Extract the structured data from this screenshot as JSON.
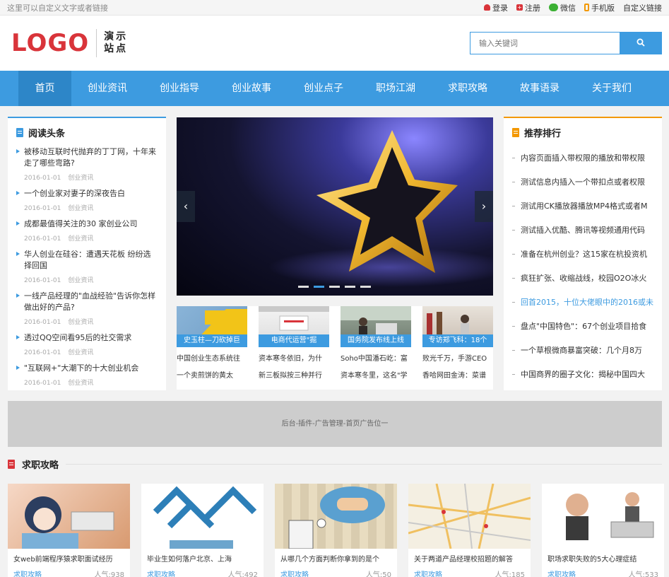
{
  "colors": {
    "accent": "#3d9be0",
    "nav_active": "#2d86c8",
    "brand_red": "#d9343a",
    "orange": "#f39800"
  },
  "topbar": {
    "left_text": "这里可以自定义文字或者链接",
    "login": "登录",
    "register": "注册",
    "wechat": "微信",
    "mobile": "手机版",
    "custom_link": "自定义链接"
  },
  "header": {
    "logo": "LOGO",
    "site_line1": "演示",
    "site_line2": "站点",
    "search_placeholder": "输入关键词",
    "search_icon": "search-icon"
  },
  "nav": [
    "首页",
    "创业资讯",
    "创业指导",
    "创业故事",
    "创业点子",
    "职场江湖",
    "求职攻略",
    "故事语录",
    "关于我们"
  ],
  "headlines": {
    "title": "阅读头条",
    "items": [
      {
        "title": "被移动互联时代抛弃的丁丁网，十年来走了哪些弯路?",
        "date": "2016-01-01",
        "cat": "创业资讯"
      },
      {
        "title": "一个创业家对妻子的深夜告白",
        "date": "2016-01-01",
        "cat": "创业资讯"
      },
      {
        "title": "成都最值得关注的30 家创业公司",
        "date": "2016-01-01",
        "cat": "创业资讯"
      },
      {
        "title": "华人创业在硅谷：遭遇天花板 纷纷选择回国",
        "date": "2016-01-01",
        "cat": "创业资讯"
      },
      {
        "title": "一线产品经理的\"血战经验\"告诉你怎样做出好的产品?",
        "date": "2016-01-01",
        "cat": "创业资讯"
      },
      {
        "title": "透过QQ空间看95后的社交需求",
        "date": "2016-01-01",
        "cat": "创业资讯"
      },
      {
        "title": "\"互联网+\"大潮下的十大创业机会",
        "date": "2016-01-01",
        "cat": "创业资讯"
      }
    ]
  },
  "slider": {
    "prev": "‹",
    "next": "›",
    "dot_count": 5,
    "active_dot": 1
  },
  "thumbs": [
    {
      "caption": "史玉柱—刀砍掉巨",
      "link1": "中国创业生态系统往",
      "link2": "一个卖煎饼的黄太"
    },
    {
      "caption": "电商代运营\"掘",
      "link1": "资本寒冬依旧，为什",
      "link2": "新三板拟按三种并行"
    },
    {
      "caption": "国务院发布线上线",
      "link1": "Soho中国潘石屹：富",
      "link2": "资本寒冬里，这名\"学"
    },
    {
      "caption": "专访郑飞科：18个",
      "link1": "败光千万，手游CEO",
      "link2": "香哈网田金涛：菜谱"
    }
  ],
  "ranking": {
    "title": "推荐排行",
    "items": [
      "内容页面插入带权限的播放和带权限",
      "测试信息内插入一个带扣点或者权限",
      "测试用CK播放器播放MP4格式或者M",
      "测试插入优酷、腾讯等视频通用代码",
      "准备在杭州创业？这15家在杭投资机",
      "疯狂扩张、收缩战线，校园O2O冰火",
      "回首2015，十位大佬眼中的2016或未",
      "盘点\"中国特色\"：67个创业项目拾食",
      "一个草根微商暴富突破：几个月8万",
      "中国商界的圈子文化：揭秘中国四大"
    ],
    "highlight_index": 6
  },
  "ad": "后台-插件-广告管理-首页广告位一",
  "section": {
    "title": "求职攻略"
  },
  "cards": [
    {
      "title": "女web前端程序猿求职面试经历",
      "cat": "求职攻略",
      "views": "人气:938"
    },
    {
      "title": "毕业生如何落户北京、上海",
      "cat": "求职攻略",
      "views": "人气:492"
    },
    {
      "title": "从哪几个方面判断你拿到的是个",
      "cat": "求职攻略",
      "views": "人气:50"
    },
    {
      "title": "关于两道产品经理校招题的解答",
      "cat": "求职攻略",
      "views": "人气:185"
    },
    {
      "title": "职场求职失败的5大心理症结",
      "cat": "求职攻略",
      "views": "人气:533"
    }
  ]
}
